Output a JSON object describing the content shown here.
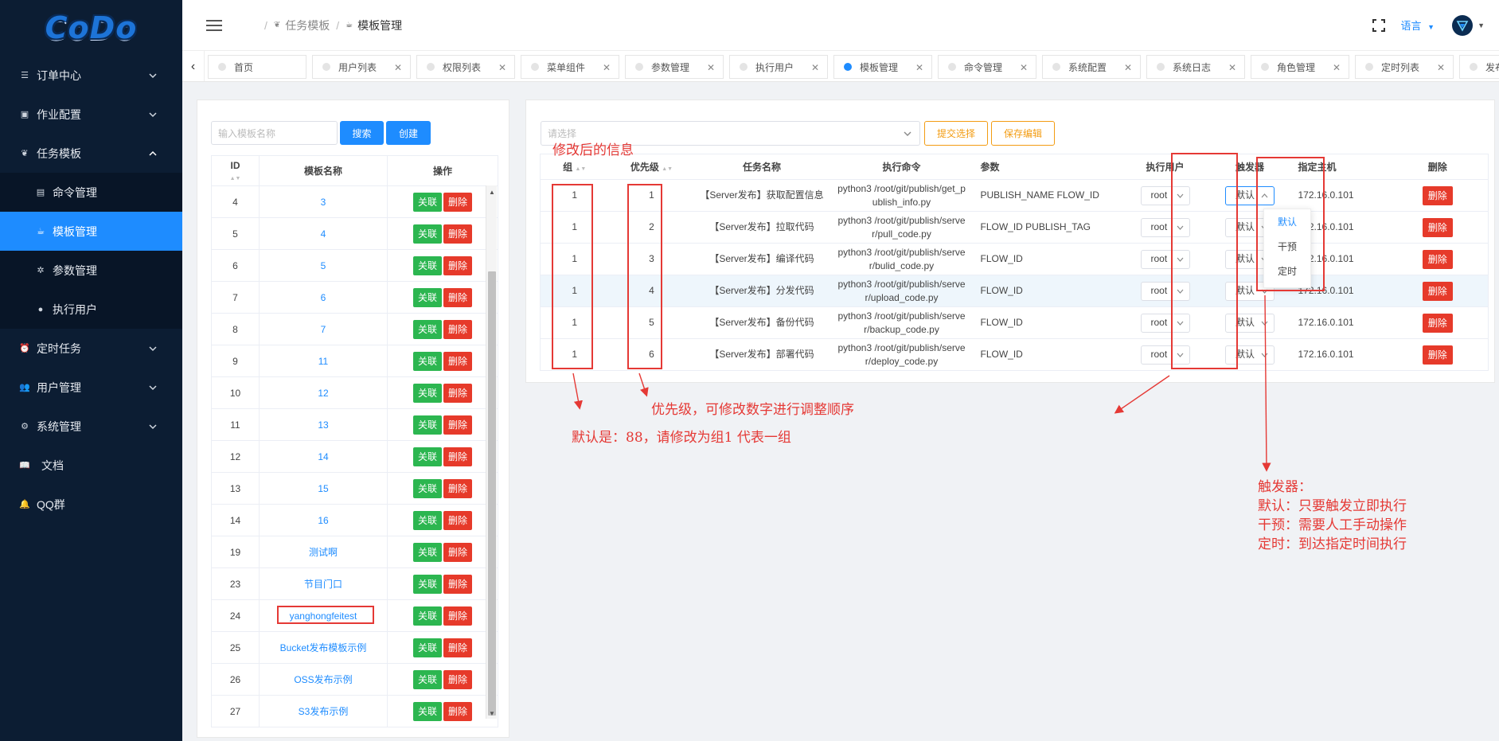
{
  "app": {
    "logo": "CoDo"
  },
  "sidebar": {
    "items": [
      {
        "label": "订单中心",
        "icon": "menu-list-icon",
        "expandable": true
      },
      {
        "label": "作业配置",
        "icon": "briefcase-icon",
        "expandable": true
      },
      {
        "label": "任务模板",
        "icon": "leaf-icon",
        "expandable": true,
        "expanded": true,
        "children": [
          {
            "label": "命令管理",
            "icon": "terminal-icon"
          },
          {
            "label": "模板管理",
            "icon": "cup-icon",
            "active": true
          },
          {
            "label": "参数管理",
            "icon": "asterisk-icon"
          },
          {
            "label": "执行用户",
            "icon": "user-circle-icon"
          }
        ]
      },
      {
        "label": "定时任务",
        "icon": "alarm-icon",
        "expandable": true
      },
      {
        "label": "用户管理",
        "icon": "users-icon",
        "expandable": true
      },
      {
        "label": "系统管理",
        "icon": "gear-icon",
        "expandable": true
      },
      {
        "label": "文档",
        "icon": "book-icon",
        "expandable": false
      },
      {
        "label": "QQ群",
        "icon": "bell-icon",
        "expandable": false
      }
    ]
  },
  "header": {
    "breadcrumb": [
      "任务模板",
      "模板管理"
    ],
    "language": "语言"
  },
  "tabs": [
    {
      "label": "首页",
      "closable": false
    },
    {
      "label": "用户列表",
      "closable": true
    },
    {
      "label": "权限列表",
      "closable": true
    },
    {
      "label": "菜单组件",
      "closable": true
    },
    {
      "label": "参数管理",
      "closable": true
    },
    {
      "label": "执行用户",
      "closable": true
    },
    {
      "label": "模板管理",
      "closable": true,
      "active": true
    },
    {
      "label": "命令管理",
      "closable": true
    },
    {
      "label": "系统配置",
      "closable": true
    },
    {
      "label": "系统日志",
      "closable": true
    },
    {
      "label": "角色管理",
      "closable": true
    },
    {
      "label": "定时列表",
      "closable": true
    },
    {
      "label": "发布配置",
      "closable": false
    }
  ],
  "left_panel": {
    "search_placeholder": "输入模板名称",
    "search_label": "搜索",
    "create_label": "创建",
    "columns": [
      "ID",
      "模板名称",
      "操作"
    ],
    "link_label": "关联",
    "delete_label": "删除",
    "rows": [
      {
        "id": "4",
        "name": "3"
      },
      {
        "id": "5",
        "name": "4"
      },
      {
        "id": "6",
        "name": "5"
      },
      {
        "id": "7",
        "name": "6"
      },
      {
        "id": "8",
        "name": "7"
      },
      {
        "id": "9",
        "name": "11"
      },
      {
        "id": "10",
        "name": "12"
      },
      {
        "id": "11",
        "name": "13"
      },
      {
        "id": "12",
        "name": "14"
      },
      {
        "id": "13",
        "name": "15"
      },
      {
        "id": "14",
        "name": "16"
      },
      {
        "id": "19",
        "name": "测试啊"
      },
      {
        "id": "23",
        "name": "节目门口"
      },
      {
        "id": "24",
        "name": "yanghongfeitest"
      },
      {
        "id": "25",
        "name": "Bucket发布模板示例"
      },
      {
        "id": "26",
        "name": "OSS发布示例"
      },
      {
        "id": "27",
        "name": "S3发布示例"
      }
    ]
  },
  "right_panel": {
    "select_placeholder": "请选择",
    "submit_label": "提交选择",
    "save_label": "保存编辑",
    "columns": [
      "组",
      "优先级",
      "任务名称",
      "执行命令",
      "参数",
      "执行用户",
      "触发器",
      "指定主机",
      "删除"
    ],
    "delete_label": "删除",
    "rows": [
      {
        "group": "1",
        "priority": "1",
        "task": "【Server发布】获取配置信息",
        "cmd1": "python3 /root/git/publish/get_p",
        "cmd2": "ublish_info.py",
        "params": "PUBLISH_NAME FLOW_ID",
        "user": "root",
        "trigger": "默认",
        "host": "172.16.0.101"
      },
      {
        "group": "1",
        "priority": "2",
        "task": "【Server发布】拉取代码",
        "cmd1": "python3 /root/git/publish/serve",
        "cmd2": "r/pull_code.py",
        "params": "FLOW_ID PUBLISH_TAG",
        "user": "root",
        "trigger": "默认",
        "host": "172.16.0.101"
      },
      {
        "group": "1",
        "priority": "3",
        "task": "【Server发布】编译代码",
        "cmd1": "python3 /root/git/publish/serve",
        "cmd2": "r/bulid_code.py",
        "params": "FLOW_ID",
        "user": "root",
        "trigger": "默认",
        "host": "172.16.0.101"
      },
      {
        "group": "1",
        "priority": "4",
        "task": "【Server发布】分发代码",
        "cmd1": "python3 /root/git/publish/serve",
        "cmd2": "r/upload_code.py",
        "params": "FLOW_ID",
        "user": "root",
        "trigger": "默认",
        "host": "172.16.0.101"
      },
      {
        "group": "1",
        "priority": "5",
        "task": "【Server发布】备份代码",
        "cmd1": "python3 /root/git/publish/serve",
        "cmd2": "r/backup_code.py",
        "params": "FLOW_ID",
        "user": "root",
        "trigger": "默认",
        "host": "172.16.0.101"
      },
      {
        "group": "1",
        "priority": "6",
        "task": "【Server发布】部署代码",
        "cmd1": "python3 /root/git/publish/serve",
        "cmd2": "r/deploy_code.py",
        "params": "FLOW_ID",
        "user": "root",
        "trigger": "默认",
        "host": "172.16.0.101"
      }
    ],
    "trigger_options": [
      "默认",
      "干预",
      "定时"
    ]
  },
  "annotations": {
    "modified_info": "修改后的信息",
    "priority_note": "优先级，可修改数字进行调整顺序",
    "group_note": "默认是：88，请修改为组1 代表一组",
    "trigger_title": "触发器：",
    "trigger_default": "默认：只要触发立即执行",
    "trigger_intervene": "干预：需要人工手动操作",
    "trigger_timed": "定时：到达指定时间执行"
  },
  "colors": {
    "sidebar_bg": "#0c1d33",
    "primary": "#1e8cff",
    "success": "#2cb650",
    "danger": "#e63a2a",
    "warning": "#f39c12",
    "annotation": "#e53935"
  }
}
